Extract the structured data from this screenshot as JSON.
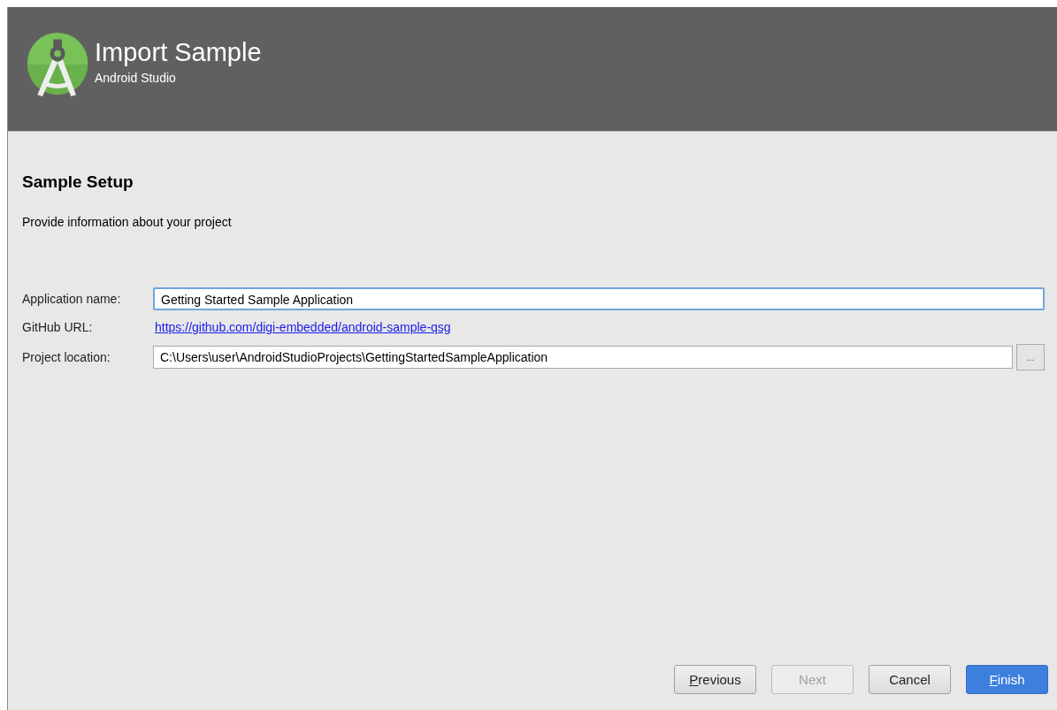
{
  "header": {
    "title": "Import Sample",
    "subtitle": "Android Studio"
  },
  "section": {
    "title": "Sample Setup",
    "description": "Provide information about your project"
  },
  "form": [
    {
      "kind": "input",
      "label": "Application name:",
      "value": "Getting Started Sample Application",
      "focused": true
    },
    {
      "kind": "link",
      "label": "GitHub URL:",
      "value": "https://github.com/digi-embedded/android-sample-qsg"
    },
    {
      "kind": "browse",
      "label": "Project location:",
      "value": "C:\\Users\\user\\AndroidStudioProjects\\GettingStartedSampleApplication",
      "focused": false,
      "button": "..."
    }
  ],
  "buttons": [
    {
      "label": "Previous",
      "disabled": false,
      "primary": false,
      "mnemonic": true
    },
    {
      "label": "Next",
      "disabled": true,
      "primary": false,
      "mnemonic": false
    },
    {
      "label": "Cancel",
      "disabled": false,
      "primary": false,
      "mnemonic": false
    },
    {
      "label": "Finish",
      "disabled": false,
      "primary": true,
      "mnemonic": true
    }
  ]
}
